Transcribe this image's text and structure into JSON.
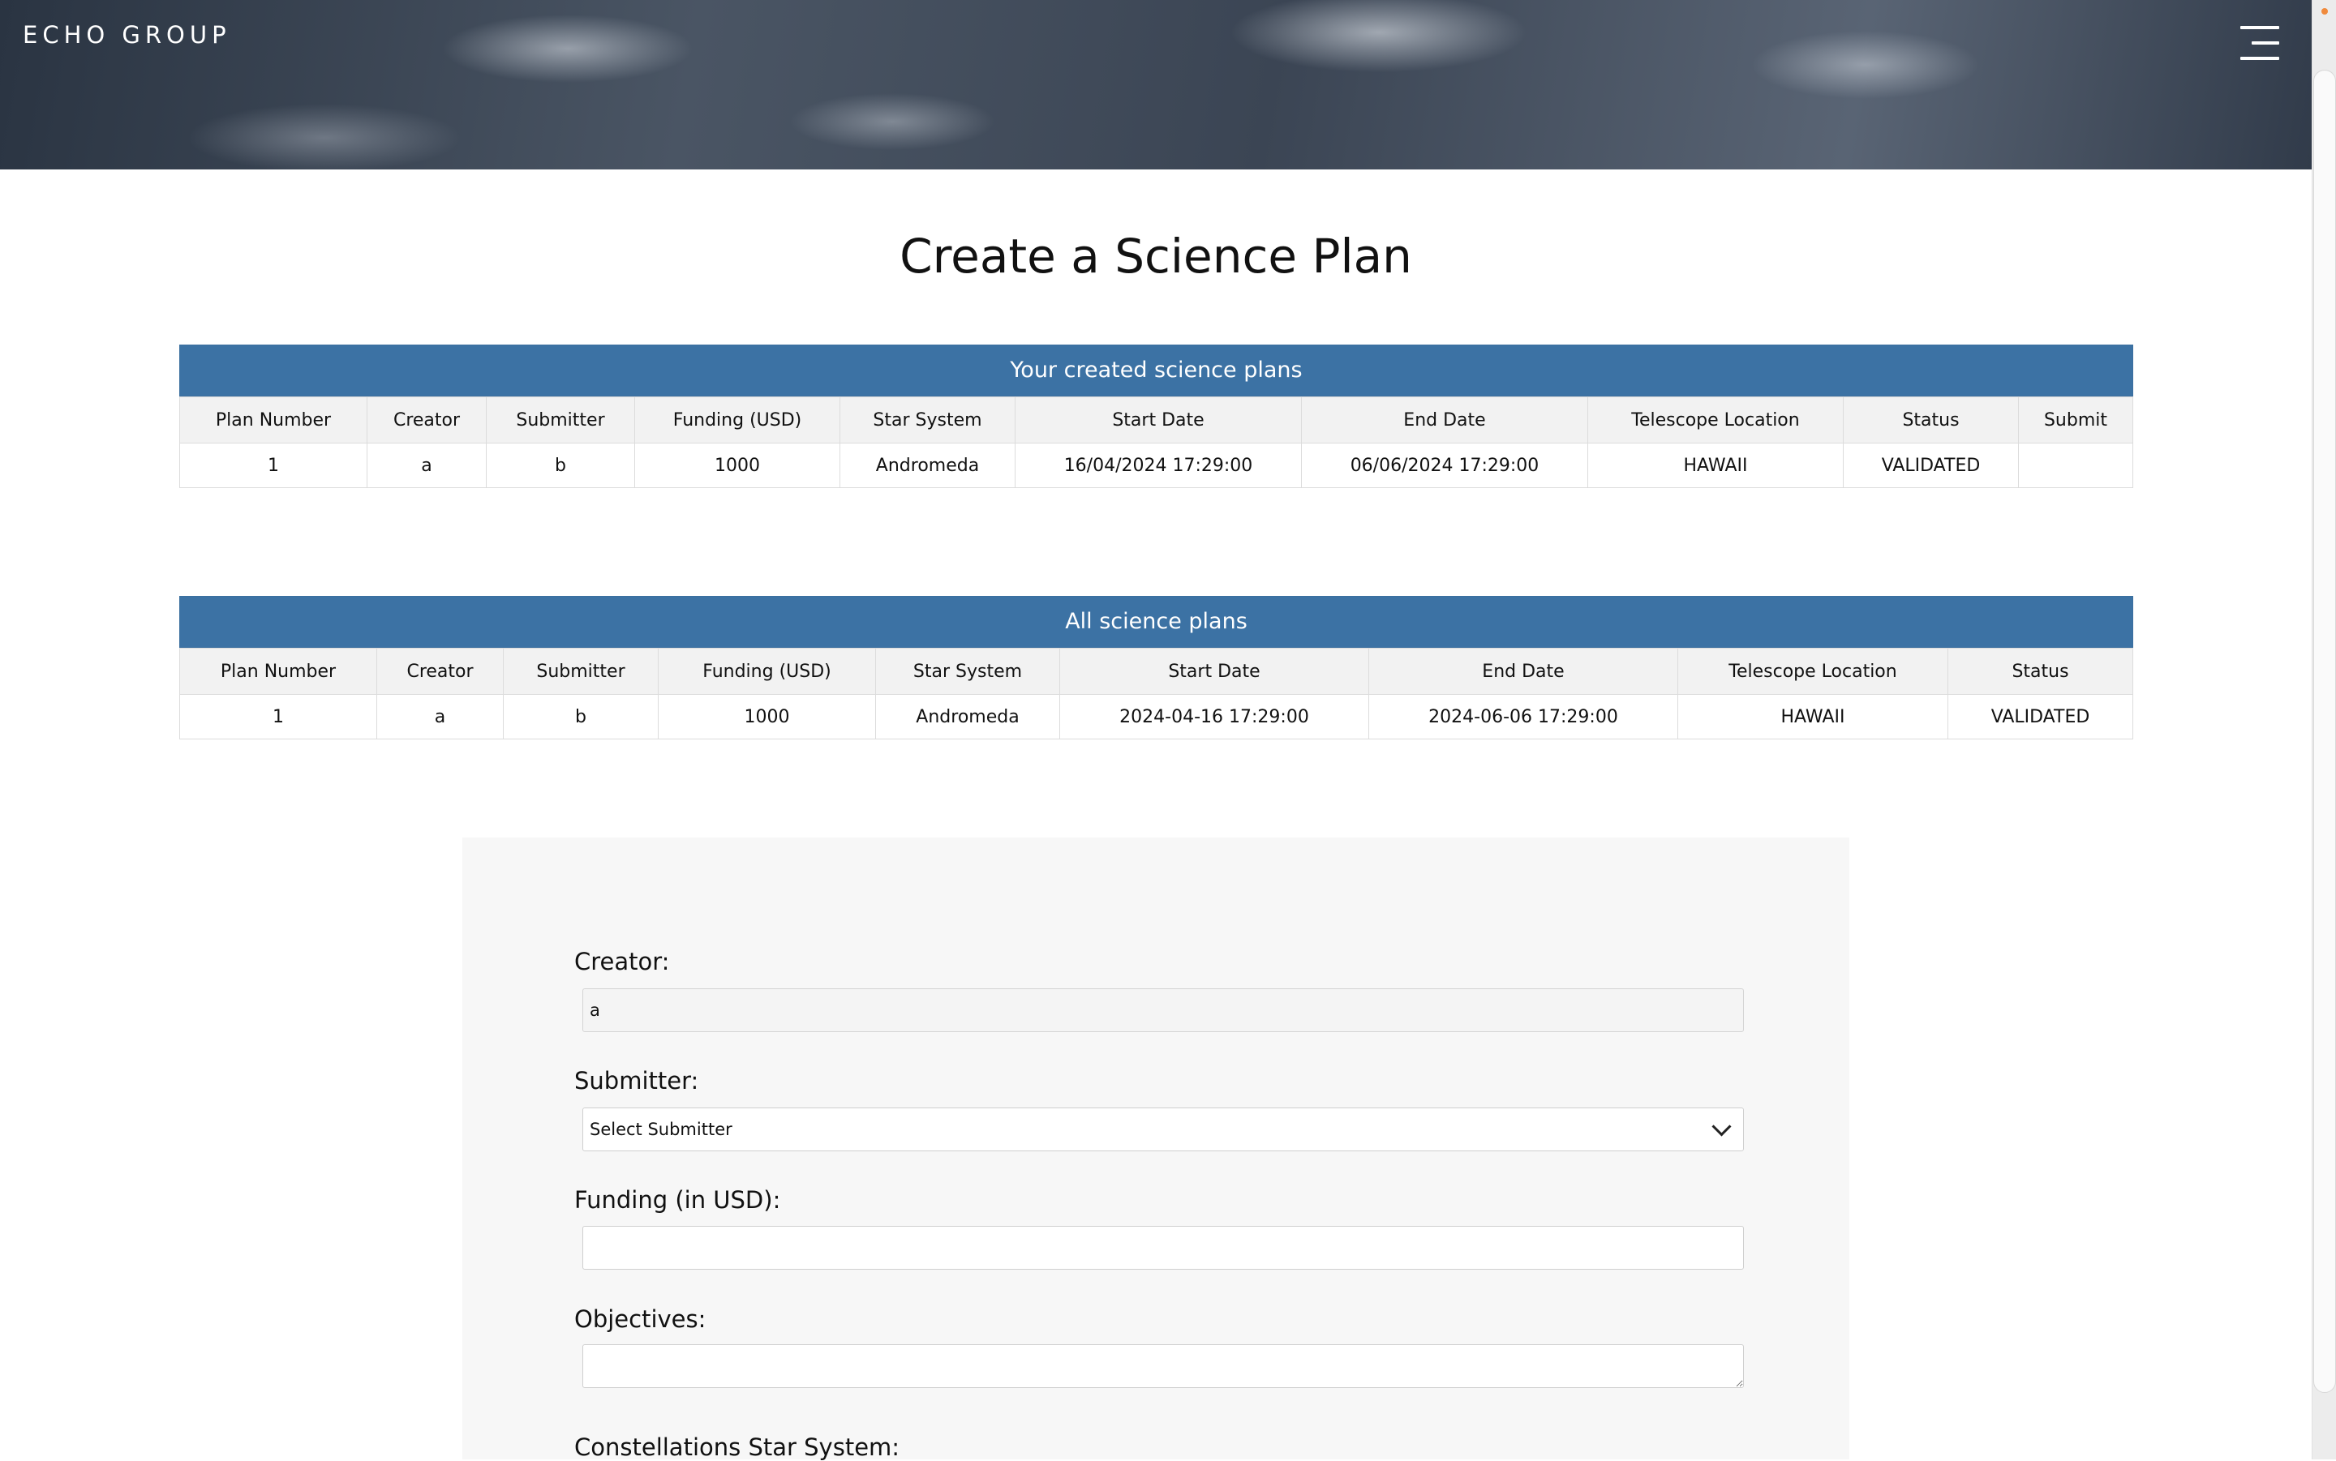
{
  "header": {
    "brand": "ECHO GROUP",
    "menu_icon": "hamburger-menu-icon"
  },
  "page": {
    "title": "Create a Science Plan"
  },
  "created_plans": {
    "caption": "Your created science plans",
    "columns": [
      "Plan Number",
      "Creator",
      "Submitter",
      "Funding (USD)",
      "Star System",
      "Start Date",
      "End Date",
      "Telescope Location",
      "Status",
      "Submit"
    ],
    "rows": [
      [
        "1",
        "a",
        "b",
        "1000",
        "Andromeda",
        "16/04/2024 17:29:00",
        "06/06/2024 17:29:00",
        "HAWAII",
        "VALIDATED",
        ""
      ]
    ]
  },
  "all_plans": {
    "caption": "All science plans",
    "columns": [
      "Plan Number",
      "Creator",
      "Submitter",
      "Funding (USD)",
      "Star System",
      "Start Date",
      "End Date",
      "Telescope Location",
      "Status"
    ],
    "rows": [
      [
        "1",
        "a",
        "b",
        "1000",
        "Andromeda",
        "2024-04-16 17:29:00",
        "2024-06-06 17:29:00",
        "HAWAII",
        "VALIDATED"
      ]
    ]
  },
  "form": {
    "creator_label": "Creator:",
    "creator_value": "a",
    "submitter_label": "Submitter:",
    "submitter_selected": "Select Submitter",
    "funding_label": "Funding (in USD):",
    "funding_value": "",
    "objectives_label": "Objectives:",
    "objectives_value": "",
    "star_system_label": "Constellations Star System:"
  },
  "colors": {
    "table_header": "#3c72a4",
    "form_panel": "#f7f7f7"
  }
}
